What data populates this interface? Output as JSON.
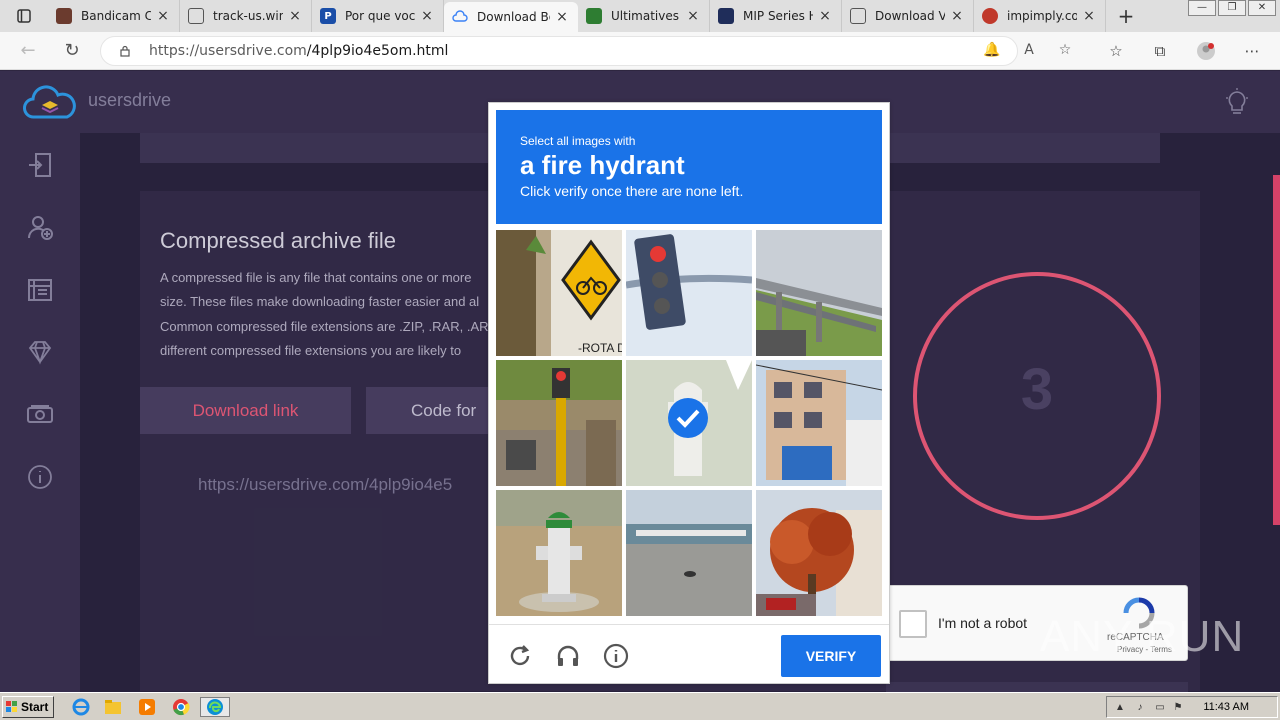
{
  "browser": {
    "tabs": [
      {
        "title": "Bandicam Cr",
        "favicon": "bandicam-icon",
        "color": "#6b3b2e"
      },
      {
        "title": "track-us.win",
        "favicon": "page-icon",
        "color": "#333333"
      },
      {
        "title": "Por que você",
        "favicon": "p-icon",
        "color": "#1a4ea8"
      },
      {
        "title": "Download Bo",
        "favicon": "usersdrive-icon",
        "color": "#3b82f6",
        "active": true
      },
      {
        "title": "Ultimatives C",
        "favicon": "ultimatives-icon",
        "color": "#2e7d32"
      },
      {
        "title": "MIP Series H",
        "favicon": "mip-icon",
        "color": "#1f2d5a"
      },
      {
        "title": "Download VI",
        "favicon": "doc-icon",
        "color": "#333333"
      },
      {
        "title": "impimply.co",
        "favicon": "impimply-icon",
        "color": "#c0392b"
      }
    ],
    "url_host": "https://usersdrive.com",
    "url_path": "/4plp9io4e5om.html"
  },
  "site": {
    "brand": "usersdrive",
    "section_title": "Compressed archive file",
    "paragraph_lines": [
      "A compressed file is any file that contains one or more",
      "size. These files make downloading faster easier and al",
      "Common compressed file extensions are .ZIP, .RAR, .AR",
      "different compressed file extensions you are likely to"
    ],
    "download_label": "Download link",
    "code_label": "Code for",
    "download_url": "https://usersdrive.com/4plp9io4e5",
    "countdown": "3",
    "accent": "#e95a7a"
  },
  "captcha": {
    "line1": "Select all images with",
    "target": "a fire hydrant",
    "line3": "Click verify once there are none left.",
    "verify_label": "VERIFY",
    "anchor_label": "I'm not a robot",
    "brand": "reCAPTCHA",
    "terms": "Privacy - Terms",
    "tiles": [
      {
        "name": "tile-bicycle-sign",
        "selected": false
      },
      {
        "name": "tile-traffic-light",
        "selected": false
      },
      {
        "name": "tile-highway-bridge",
        "selected": false
      },
      {
        "name": "tile-street-traffic-light",
        "selected": false
      },
      {
        "name": "tile-hydrant-faded",
        "selected": true
      },
      {
        "name": "tile-building",
        "selected": false
      },
      {
        "name": "tile-fire-hydrant",
        "selected": false
      },
      {
        "name": "tile-parking-lot",
        "selected": false
      },
      {
        "name": "tile-tree-house",
        "selected": false
      }
    ],
    "accent": "#1a73e8"
  },
  "watermark": "ANY RUN",
  "taskbar": {
    "start_label": "Start",
    "clock": "11:43 AM"
  }
}
